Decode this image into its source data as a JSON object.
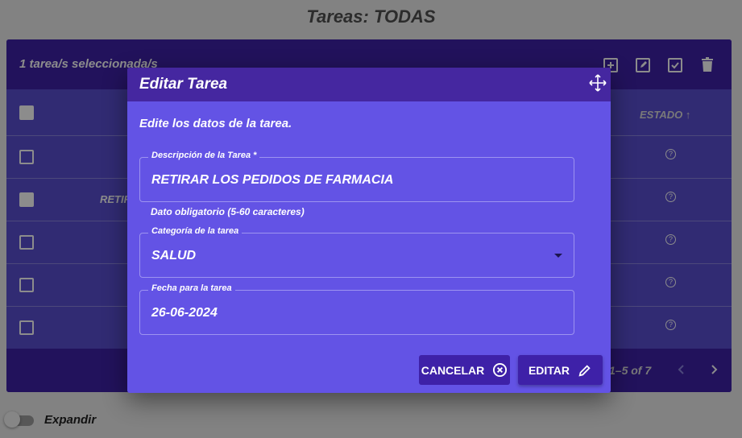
{
  "page": {
    "title": "Tareas: TODAS"
  },
  "toolbar": {
    "selection_text": "1 tarea/s seleccionada/s"
  },
  "table": {
    "state_header": "ESTADO ↑",
    "visible_row_text": "RETIR",
    "status_icon": "?"
  },
  "pager": {
    "range": "1–5 of 7"
  },
  "footer": {
    "expand_label": "Expandir"
  },
  "dialog": {
    "title": "Editar Tarea",
    "subtitle": "Edite los datos de la tarea.",
    "description_label": "Descripción de la Tarea *",
    "description_value": "RETIRAR LOS PEDIDOS DE FARMACIA",
    "description_hint": "Dato obligatorio (5-60 caracteres)",
    "category_label": "Categoría de la tarea",
    "category_value": "SALUD",
    "date_label": "Fecha para la tarea",
    "date_value": "26-06-2024",
    "cancel_label": "CANCELAR",
    "edit_label": "EDITAR"
  }
}
